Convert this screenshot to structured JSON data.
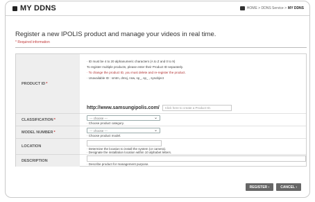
{
  "header": {
    "title": "MY DDNS",
    "breadcrumb": {
      "home": "HOME",
      "sep1": ">",
      "service": "DDNS Service",
      "sep2": ">",
      "current": "MY DDNS"
    }
  },
  "intro": {
    "headline": "Register a new IPOLIS product and manage your videos in real time.",
    "required_note": "* Required information"
  },
  "form": {
    "product_id": {
      "label": "PRODUCT ID",
      "star": "*",
      "notes": [
        "· ID must be 4 to 20 alphanumeric characters (A to Z and 0 to 9)",
        "To register multiple products, please enter their Product ID separately.",
        "· To change the product ID, you must delete and re-register the product.",
        "· Unavailable ID : smtm, dmsj, nsw, sp_, sp_ , sysobject"
      ],
      "url_prefix": "http://www.samsungipolis.com/",
      "placeholder": "Click here to create a Product ID."
    },
    "classification": {
      "label": "CLASSIFICATION",
      "star": "*",
      "selected": "--- choose ---",
      "note": "· Choose product category."
    },
    "model_number": {
      "label": "MODEL NUMBER",
      "star": "*",
      "selected": "--- choose ---",
      "note": "· Choose product model."
    },
    "location": {
      "label": "LOCATION",
      "notes": [
        "· Determine the location to install the system (or camera).",
        "· Designate the installation location within 10 alphabet letters."
      ]
    },
    "description": {
      "label": "DESCRIPTION",
      "note": "· Describe product for management purpose."
    }
  },
  "actions": {
    "register": "REGISTER ›",
    "cancel": "CANCEL ›"
  }
}
